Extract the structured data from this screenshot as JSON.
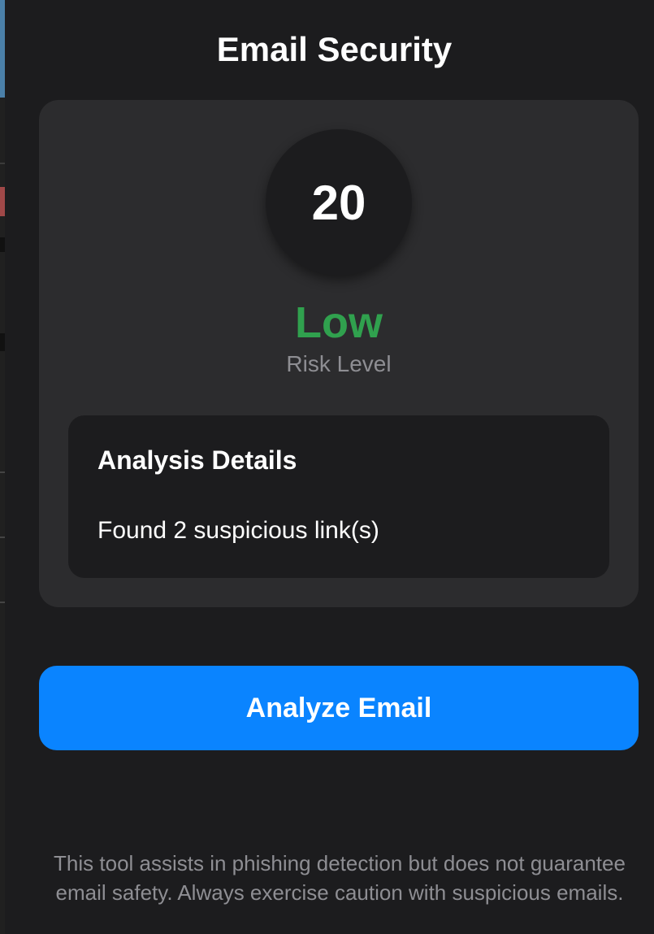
{
  "header": {
    "title": "Email Security"
  },
  "result": {
    "score": "20",
    "risk_level": "Low",
    "risk_caption": "Risk Level",
    "risk_color": "#30a14e"
  },
  "details": {
    "title": "Analysis Details",
    "items": [
      "Found 2 suspicious link(s)"
    ]
  },
  "actions": {
    "analyze_label": "Analyze Email",
    "accent_color": "#0a84ff"
  },
  "footer": {
    "disclaimer_line1": "This tool assists in phishing detection but does not guarantee",
    "disclaimer_line2": "email safety. Always exercise caution with suspicious emails."
  }
}
